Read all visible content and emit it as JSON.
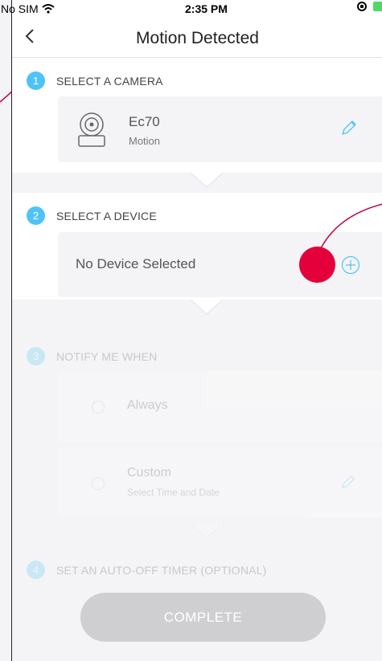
{
  "status_bar": {
    "carrier": "No SIM",
    "time": "2:35 PM"
  },
  "nav": {
    "title": "Motion Detected"
  },
  "steps": {
    "camera": {
      "number": "1",
      "title": "SELECT A CAMERA",
      "device_name": "Ec70",
      "device_sub": "Motion"
    },
    "device": {
      "number": "2",
      "title": "SELECT A DEVICE",
      "placeholder": "No Device Selected"
    },
    "notify": {
      "number": "3",
      "title": "NOTIFY ME WHEN",
      "options": [
        {
          "label": "Always",
          "sub": ""
        },
        {
          "label": "Custom",
          "sub": "Select Time and Date"
        }
      ]
    },
    "timer": {
      "number": "4",
      "title": "SET AN AUTO-OFF TIMER (OPTIONAL)"
    }
  },
  "complete_button": {
    "label": "COMPLETE"
  },
  "colors": {
    "accent": "#4fc3f7",
    "highlight": "#e4003b"
  }
}
